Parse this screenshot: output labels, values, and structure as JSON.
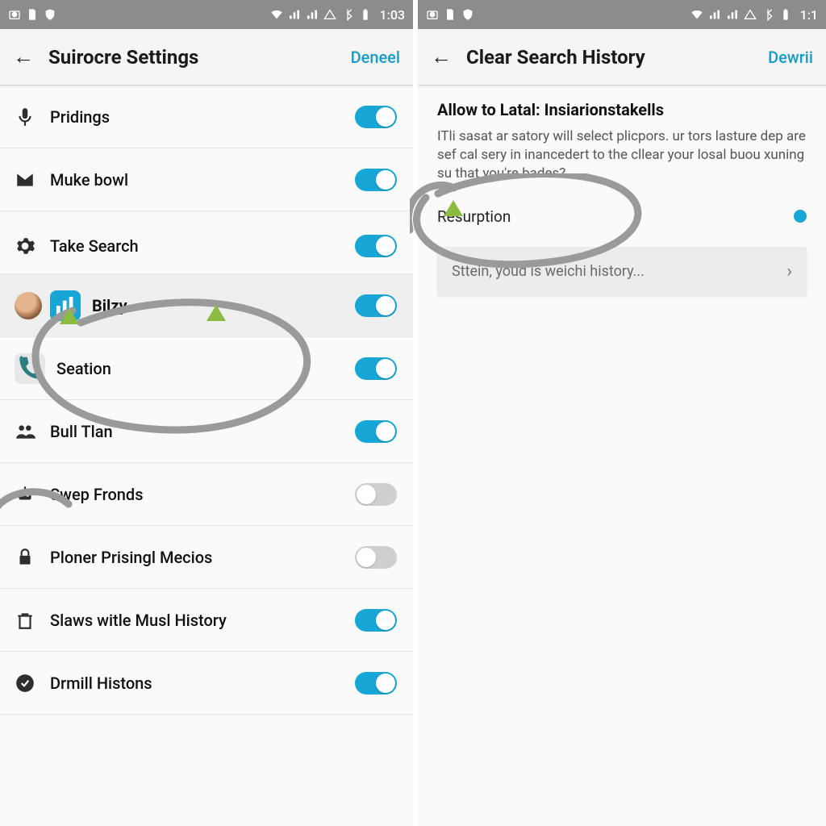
{
  "left": {
    "status_time": "1:03",
    "title": "Suirocre Settings",
    "action": "Deneel",
    "rows": [
      {
        "icon": "mic",
        "label": "Pridings",
        "on": true
      },
      {
        "icon": "mail",
        "label": "Muke bowl",
        "on": true
      },
      {
        "icon": "gear-dark",
        "label": "Take Search",
        "on": true
      },
      {
        "icon": "app-bars",
        "label": "Bilzy",
        "on": true,
        "bold": true,
        "highlight": true,
        "avatar": true
      },
      {
        "icon": "phone",
        "label": "Seation",
        "on": true
      },
      {
        "icon": "people",
        "label": "Bull Tlan",
        "on": true
      },
      {
        "icon": "robot",
        "label": "Swep Fronds",
        "on": false
      },
      {
        "icon": "lock",
        "label": "Ploner Prisingl Mecios",
        "on": false
      },
      {
        "icon": "trash",
        "label": "Slaws witle Musl History",
        "on": true
      },
      {
        "icon": "check",
        "label": "Drmill Histons",
        "on": true
      }
    ]
  },
  "right": {
    "status_time": "1:1",
    "title": "Clear Search History",
    "action": "Dewrii",
    "heading": "Allow to Latal: Insiarionstakells",
    "body": "ITli sasat ar satory will select plicpors. ur tors lasture dep are sef cal sery in inancedert to the cllear your losal buou xuning su that you're bades?.",
    "radio_label": "Resurption",
    "card_text": "Sttein, youd is weichi history...",
    "subtle_word": "weichi"
  },
  "colors": {
    "accent": "#17a6d6",
    "anno": "#9a9a9a",
    "triangle": "#8bbb3f"
  }
}
